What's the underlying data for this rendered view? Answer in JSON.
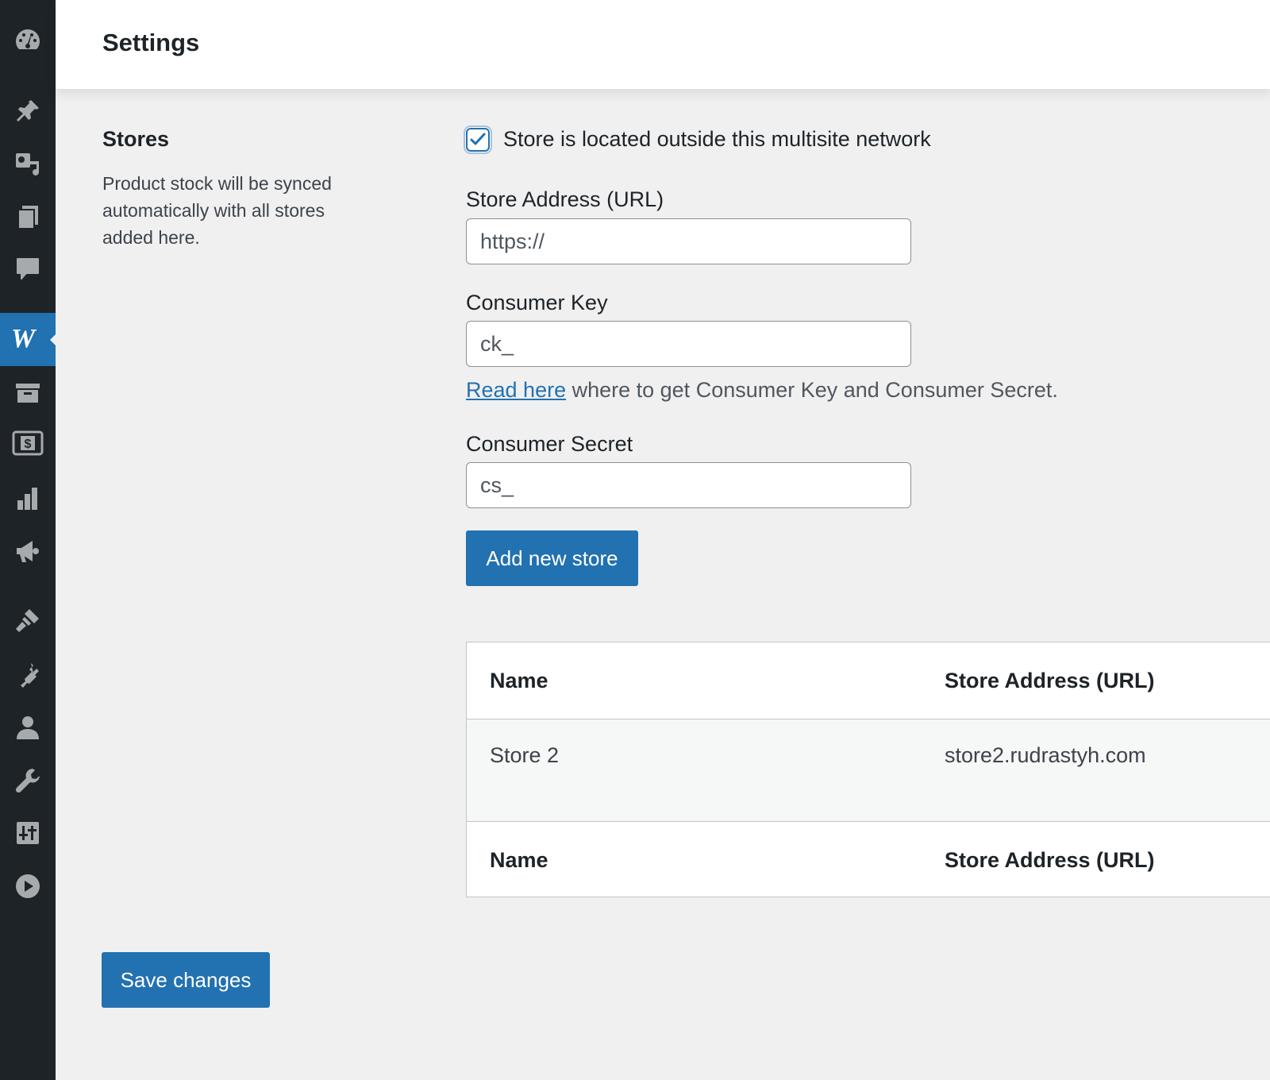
{
  "header": {
    "title": "Settings"
  },
  "sidebar": {
    "items": [
      {
        "icon": "dashboard-icon"
      },
      {
        "icon": "posts-pin-icon"
      },
      {
        "icon": "media-icon"
      },
      {
        "icon": "pages-icon"
      },
      {
        "icon": "comments-icon"
      },
      {
        "icon": "woocommerce-icon",
        "label": "W",
        "active": true
      },
      {
        "icon": "products-archive-icon"
      },
      {
        "icon": "payments-dollar-icon"
      },
      {
        "icon": "analytics-icon"
      },
      {
        "icon": "marketing-megaphone-icon"
      },
      {
        "icon": "appearance-brush-icon"
      },
      {
        "icon": "plugins-icon"
      },
      {
        "icon": "users-icon"
      },
      {
        "icon": "tools-wrench-icon"
      },
      {
        "icon": "settings-sliders-icon"
      },
      {
        "icon": "play-icon"
      }
    ]
  },
  "section": {
    "title": "Stores",
    "description": "Product stock will be synced automatically with all stores added here."
  },
  "form": {
    "outside_network": {
      "label": "Store is located outside this multisite network",
      "checked": true
    },
    "store_address": {
      "label": "Store Address (URL)",
      "value": "https://"
    },
    "consumer_key": {
      "label": "Consumer Key",
      "value": "ck_"
    },
    "help": {
      "link_text": "Read here",
      "text": " where to get Consumer Key and Consumer Secret."
    },
    "consumer_secret": {
      "label": "Consumer Secret",
      "value": "cs_"
    },
    "add_button": "Add new store"
  },
  "table": {
    "headers": [
      "Name",
      "Store Address (URL)"
    ],
    "rows": [
      {
        "name": "Store 2",
        "url": "store2.rudrastyh.com"
      }
    ],
    "footer": [
      "Name",
      "Store Address (URL)"
    ]
  },
  "save_button": "Save changes",
  "colors": {
    "accent": "#2271b1",
    "sidebar": "#1d2327",
    "background": "#f0f0f1"
  }
}
